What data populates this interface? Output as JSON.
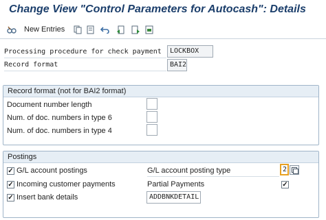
{
  "title": "Change View \"Control Parameters for Autocash\": Details",
  "toolbar": {
    "new_entries_label": "New Entries",
    "icons": [
      "edit-glasses-icon",
      "copy-as-icon",
      "delete-icon",
      "undo-change-icon",
      "previous-entry-icon",
      "next-entry-icon",
      "transport-icon",
      "select-all-icon"
    ]
  },
  "header_fields": {
    "processing_label": "Processing procedure for check payment",
    "processing_value": "LOCKBOX",
    "record_format_label": "Record format",
    "record_format_value": "BAI2"
  },
  "record_format_group": {
    "title": "Record format (not for BAI2 format)",
    "rows": [
      {
        "label": "Document number length",
        "value": ""
      },
      {
        "label": "Num. of doc. numbers in type 6",
        "value": ""
      },
      {
        "label": "Num. of doc. numbers in type 4",
        "value": ""
      }
    ]
  },
  "postings_group": {
    "title": "Postings",
    "gl_postings_label": "G/L account postings",
    "gl_postings_checked": "✓",
    "incoming_label": "Incoming customer payments",
    "incoming_checked": "✓",
    "insert_bank_label": "Insert bank details",
    "insert_bank_checked": "✓",
    "gl_posting_type_label": "G/L account posting type",
    "gl_posting_type_value": "2",
    "partial_payments_label": "Partial Payments",
    "partial_payments_checked": "✓",
    "bank_structure_value": "ADDBNKDETAIL"
  }
}
